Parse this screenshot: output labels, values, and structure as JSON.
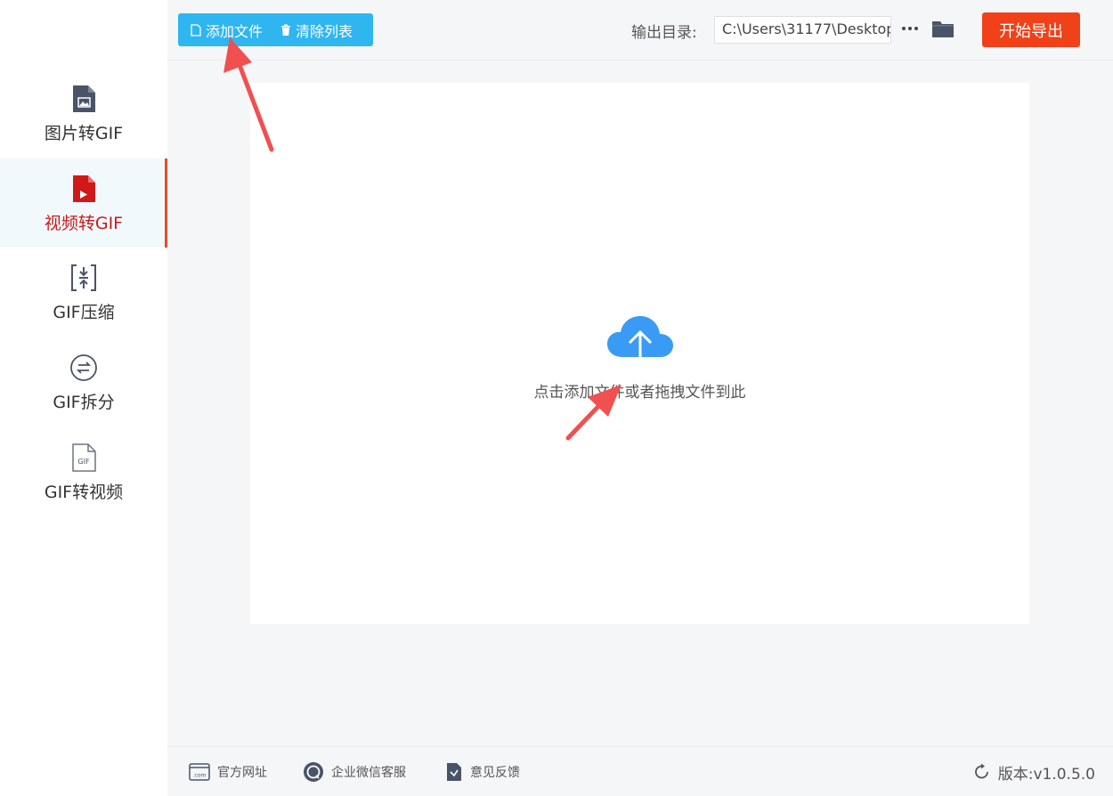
{
  "sidebar": {
    "items": [
      {
        "label": "图片转GIF",
        "icon": "image-file-icon"
      },
      {
        "label": "视频转GIF",
        "icon": "video-file-icon",
        "active": true
      },
      {
        "label": "GIF压缩",
        "icon": "compress-icon"
      },
      {
        "label": "GIF拆分",
        "icon": "split-icon"
      },
      {
        "label": "GIF转视频",
        "icon": "gif-file-icon"
      }
    ]
  },
  "toolbar": {
    "add_file_label": "添加文件",
    "clear_list_label": "清除列表",
    "output_dir_label": "输出目录:",
    "output_path": "C:\\Users\\31177\\Desktop",
    "more_label": "···",
    "export_label": "开始导出"
  },
  "dropzone": {
    "hint": "点击添加文件或者拖拽文件到此"
  },
  "footer": {
    "website_label": "官方网址",
    "wechat_label": "企业微信客服",
    "feedback_label": "意见反馈",
    "version_label": "版本:v1.0.5.0"
  },
  "colors": {
    "primary_blue": "#2fb5f0",
    "export_red": "#f04119",
    "active_red": "#c81c1c",
    "upload_blue": "#3a9bf5",
    "arrow_red": "#f05050"
  }
}
